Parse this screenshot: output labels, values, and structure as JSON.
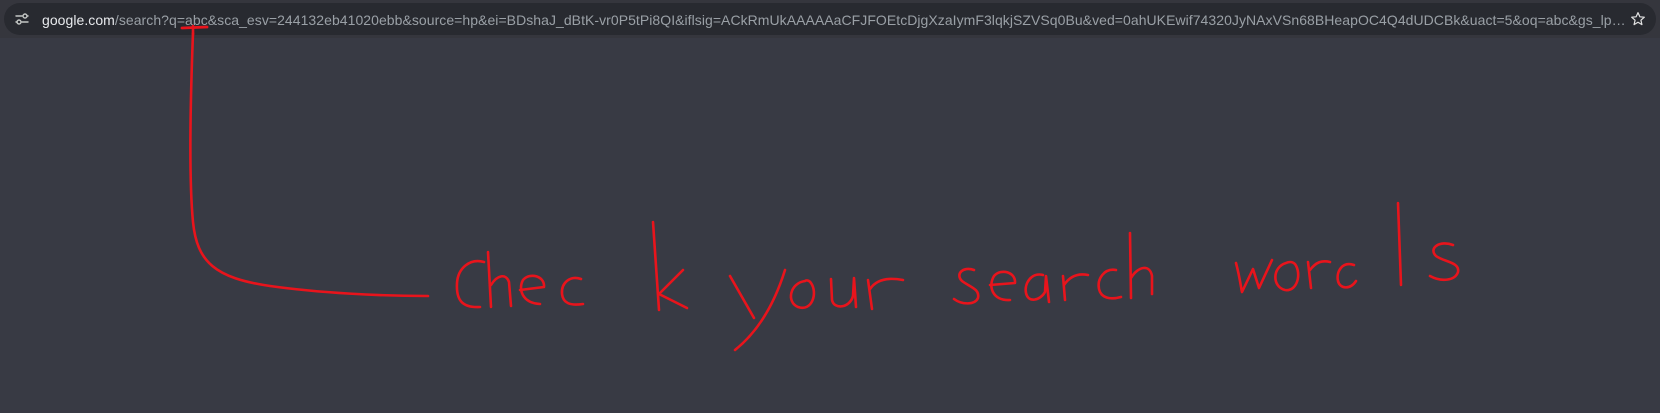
{
  "browser": {
    "address_bar": {
      "domain": "google.com",
      "path": "/search?q=abc&sca_esv=244132eb41020ebb&source=hp&ei=BDshaJ_dBtK-vr0P5tPi8QI&iflsig=ACkRmUkAAAAAaCFJFOEtcDjgXzaIymF3lqkjSZVSq0Bu&ved=0ahUKEwif74320JyNAxVSn68BHeapOC4Q4dUDCBk&uact=5&oq=abc&gs_lp=E…",
      "site_info_icon": "tune-icon",
      "bookmark_icon": "star-outline-icon"
    }
  },
  "annotation": {
    "handwritten_text": "Check your search words",
    "color": "#e8141c"
  },
  "colors": {
    "page_background": "#383a44",
    "toolbar_background": "#35363d",
    "omnibox_background": "#282a30",
    "url_domain": "#e8eaed",
    "url_path": "#9aa0a6"
  }
}
